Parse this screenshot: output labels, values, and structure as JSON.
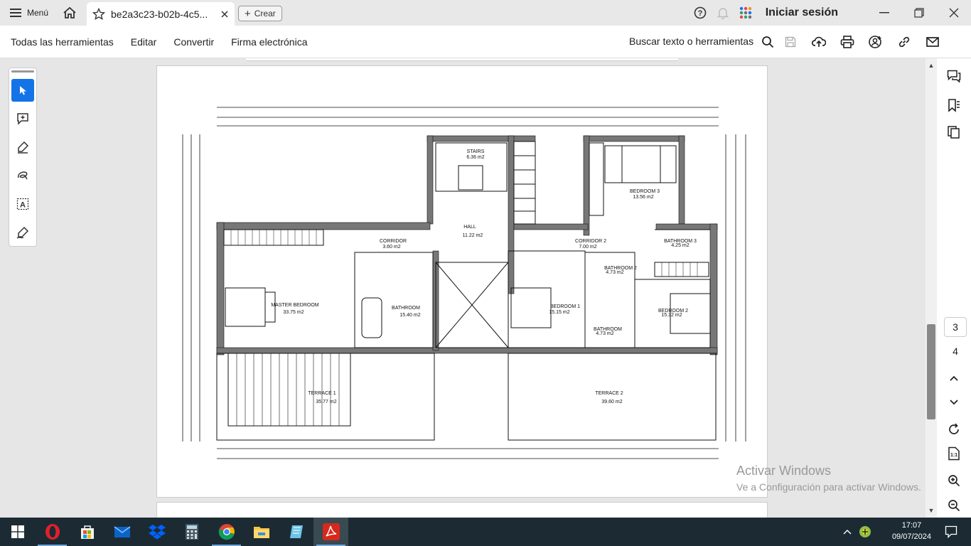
{
  "titlebar": {
    "menu_label": "Menú",
    "tab_title": "be2a3c23-b02b-4c5...",
    "create_label": "Crear",
    "signin_label": "Iniciar sesión"
  },
  "toolbar": {
    "items": [
      "Todas las herramientas",
      "Editar",
      "Convertir",
      "Firma electrónica"
    ],
    "search_label": "Buscar texto o herramientas"
  },
  "plan": {
    "rooms": [
      {
        "name": "STAIRS",
        "area": "6.36 m2"
      },
      {
        "name": "HALL",
        "area": "11.22 m2"
      },
      {
        "name": "BEDROOM 3",
        "area": "13.56 m2"
      },
      {
        "name": "CORRIDOR",
        "area": "3.60 m2"
      },
      {
        "name": "CORRIDOR 2",
        "area": "7.00 m2"
      },
      {
        "name": "BATHROOM 3",
        "area": "4.25 m2"
      },
      {
        "name": "MASTER BEDROOM",
        "area": "33.75 m2"
      },
      {
        "name": "BATHROOM",
        "area": "15.40 m2"
      },
      {
        "name": "BATHROOM 2",
        "area": "4.73 m2"
      },
      {
        "name": "BEDROOM 1",
        "area": "15.15 m2"
      },
      {
        "name": "BEDROOM 2",
        "area": "15.32 m2"
      },
      {
        "name": "BATHROOM",
        "area": "4.73 m2"
      },
      {
        "name": "TERRACE 1",
        "area": "35.77 m2"
      },
      {
        "name": "TERRACE 2",
        "area": "39.60 m2"
      }
    ]
  },
  "watermark": {
    "line1": "Activar Windows",
    "line2": "Ve a Configuración para activar Windows."
  },
  "pages": {
    "current": "3",
    "next": "4"
  },
  "clock": {
    "time": "17:07",
    "date": "09/07/2024"
  }
}
